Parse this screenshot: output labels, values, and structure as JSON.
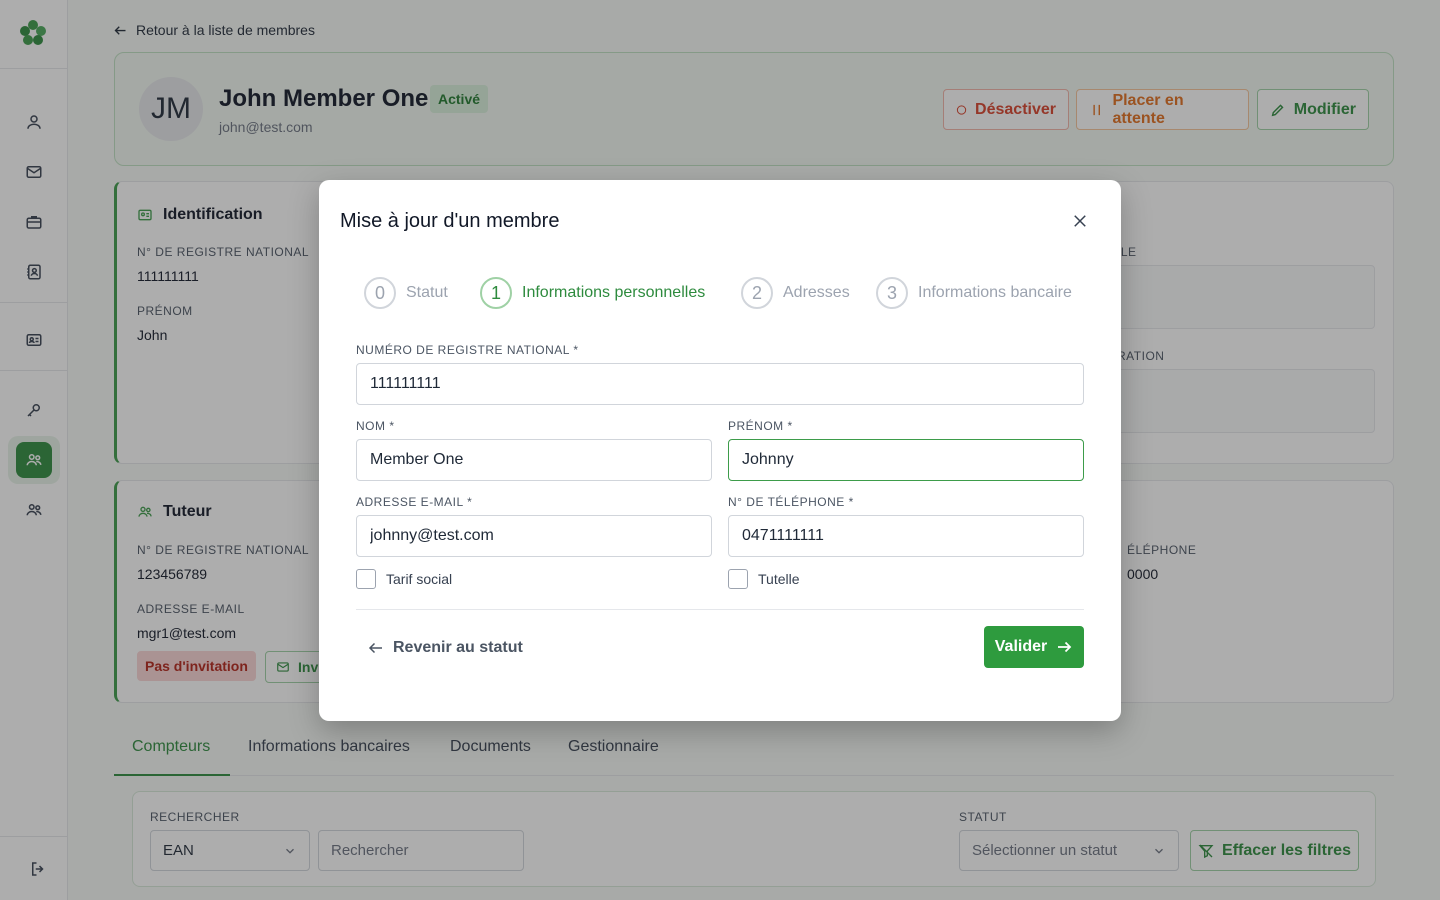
{
  "page": {
    "back_link": "Retour à la liste de membres"
  },
  "member": {
    "initials": "JM",
    "name": "John Member One",
    "status": "Activé",
    "email": "john@test.com",
    "actions": {
      "deactivate": "Désactiver",
      "hold": "Placer en attente",
      "edit": "Modifier"
    }
  },
  "identification": {
    "title": "Identification",
    "national_register_label": "N° DE REGISTRE NATIONAL",
    "national_register_value": "111111111",
    "firstname_label": "PRÉNOM",
    "firstname_value": "John",
    "right_label_1": "ILE",
    "right_label_2": "RATION"
  },
  "tutor": {
    "title": "Tuteur",
    "national_register_label": "N° DE REGISTRE NATIONAL",
    "national_register_value": "123456789",
    "email_label": "ADRESSE E-MAIL",
    "email_value": "mgr1@test.com",
    "invite_status": "Pas d'invitation",
    "invite_button": "Invi",
    "phone_label_fragment": "ÉLÉPHONE",
    "phone_value_fragment": "0000"
  },
  "tabs": [
    "Compteurs",
    "Informations bancaires",
    "Documents",
    "Gestionnaire"
  ],
  "filters": {
    "search_label": "RECHERCHER",
    "search_type": "EAN",
    "search_placeholder": "Rechercher",
    "status_label": "STATUT",
    "status_placeholder": "Sélectionner un statut",
    "clear": "Effacer les filtres"
  },
  "modal": {
    "title": "Mise à jour d'un membre",
    "steps": [
      {
        "num": "0",
        "label": "Statut"
      },
      {
        "num": "1",
        "label": "Informations personnelles"
      },
      {
        "num": "2",
        "label": "Adresses"
      },
      {
        "num": "3",
        "label": "Informations bancaire"
      }
    ],
    "active_step": 1,
    "fields": {
      "national_register": {
        "label": "NUMÉRO DE REGISTRE NATIONAL *",
        "value": "111111111"
      },
      "lastname": {
        "label": "NOM *",
        "value": "Member One"
      },
      "firstname": {
        "label": "PRÉNOM *",
        "value": "Johnny"
      },
      "email": {
        "label": "ADRESSE E-MAIL *",
        "value": "johnny@test.com"
      },
      "phone": {
        "label": "N° DE TÉLÉPHONE *",
        "value": "0471111111"
      }
    },
    "checkboxes": {
      "social_rate": "Tarif social",
      "guardianship": "Tutelle"
    },
    "back_button": "Revenir au statut",
    "submit_button": "Valider"
  },
  "colors": {
    "primary": "#2e8b3e",
    "danger": "#d9412b",
    "warning": "#e36f1e"
  }
}
